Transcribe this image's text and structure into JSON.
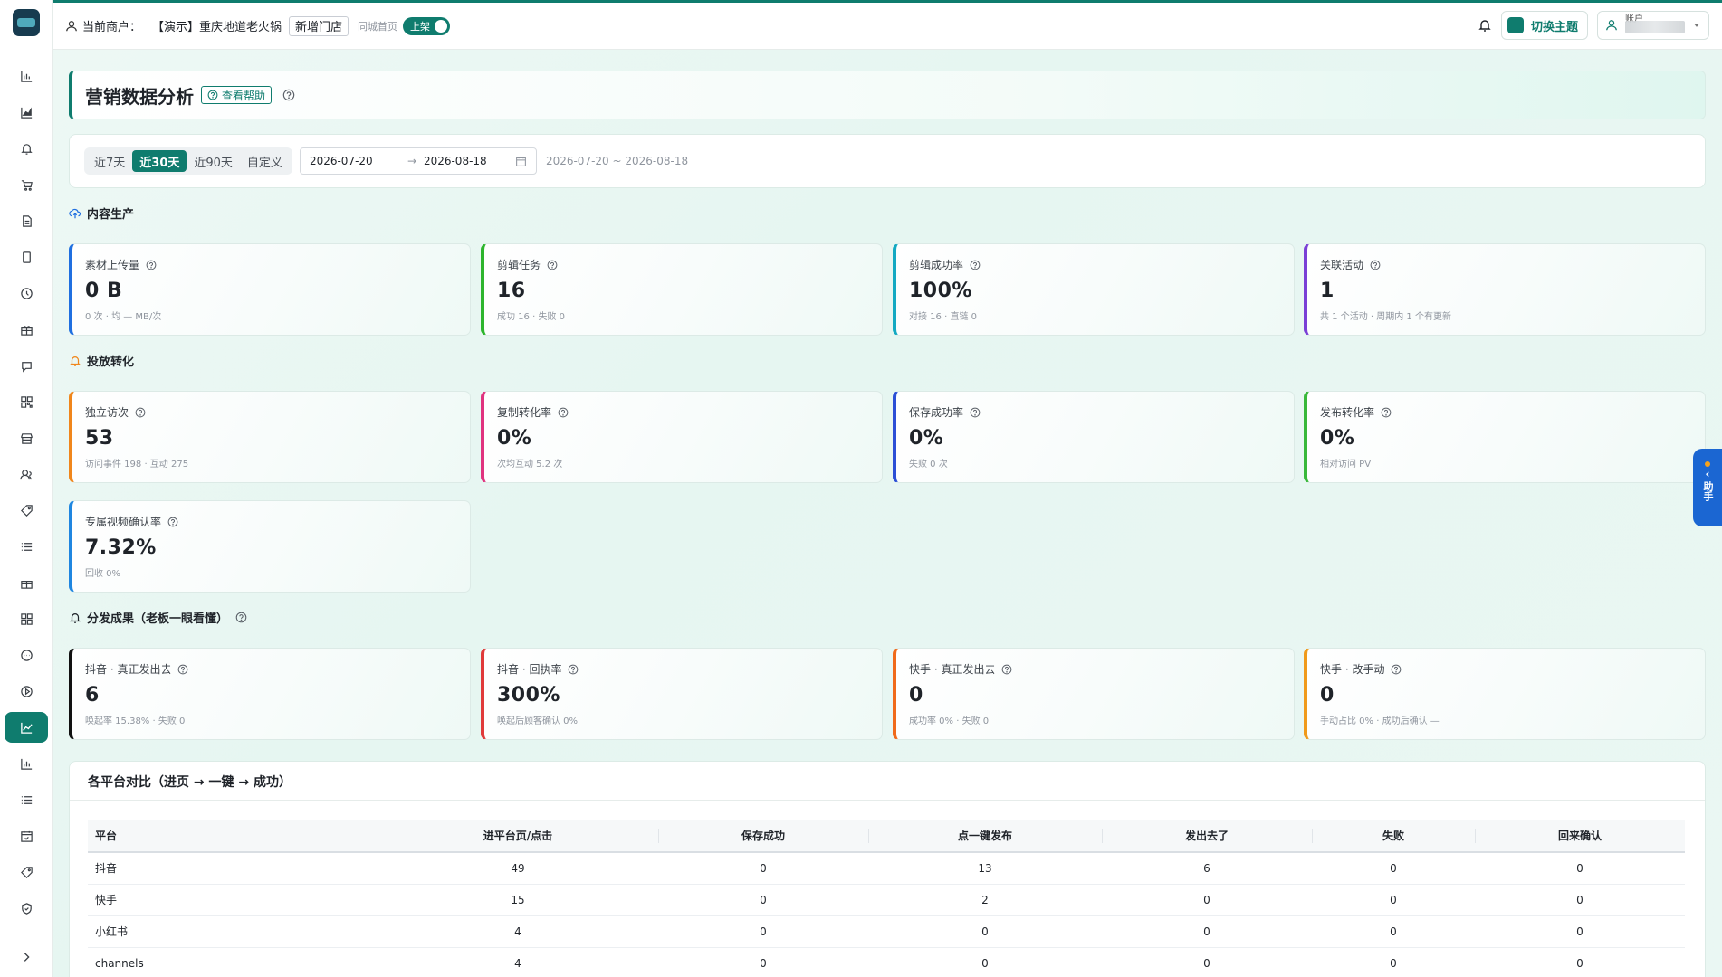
{
  "topbar": {
    "merchant_label": "当前商户：",
    "merchant_name": "【演示】重庆地道老火锅",
    "add_store": "新增门店",
    "city_home_label": "同城首页",
    "toggle_label": "上架",
    "theme_button": "切换主题",
    "user_name_short": "账户"
  },
  "header": {
    "title": "营销数据分析",
    "help_button": "查看帮助"
  },
  "filter": {
    "segments": [
      "近7天",
      "近30天",
      "近90天",
      "自定义"
    ],
    "active_segment": "近30天",
    "start_date": "2026-07-20",
    "end_date": "2026-08-18",
    "range_text": "2026-07-20 ~ 2026-08-18"
  },
  "sections": {
    "content": "内容生产",
    "delivery": "投放转化",
    "distribution": "分发成果（老板一眼看懂）"
  },
  "kpis": {
    "content": [
      {
        "label": "素材上传量",
        "value": "0 B",
        "sub": "0 次 · 均 — MB/次",
        "color": "#1f6fe0"
      },
      {
        "label": "剪辑任务",
        "value": "16",
        "sub": "成功 16 · 失败 0",
        "color": "#2db52d"
      },
      {
        "label": "剪辑成功率",
        "value": "100%",
        "sub": "对接 16 · 直链 0",
        "color": "#14a9c2"
      },
      {
        "label": "关联活动",
        "value": "1",
        "sub": "共 1 个活动 · 周期内 1 个有更新",
        "color": "#7a3fd6"
      }
    ],
    "delivery": [
      {
        "label": "独立访次",
        "value": "53",
        "sub": "访问事件 198 · 互动 275",
        "color": "#f0861b"
      },
      {
        "label": "复制转化率",
        "value": "0%",
        "sub": "次均互动 5.2 次",
        "color": "#e0337f"
      },
      {
        "label": "保存成功率",
        "value": "0%",
        "sub": "失败 0 次",
        "color": "#2c4fd6"
      },
      {
        "label": "发布转化率",
        "value": "0%",
        "sub": "相对访问 PV",
        "color": "#39b83a"
      },
      {
        "label": "专属视频确认率",
        "value": "7.32%",
        "sub": "回收 0%",
        "color": "#1f86e0"
      }
    ],
    "distribution": [
      {
        "label": "抖音 · 真正发出去",
        "value": "6",
        "sub": "唤起率 15.38% · 失败 0",
        "color": "#111111"
      },
      {
        "label": "抖音 · 回执率",
        "value": "300%",
        "sub": "唤起后顾客确认 0%",
        "color": "#e03a3a"
      },
      {
        "label": "快手 · 真正发出去",
        "value": "0",
        "sub": "成功率 0% · 失败 0",
        "color": "#f06a1b"
      },
      {
        "label": "快手 · 改手动",
        "value": "0",
        "sub": "手动占比 0% · 成功后确认 —",
        "color": "#f09a1b"
      }
    ]
  },
  "platform_table": {
    "title": "各平台对比（进页 → 一键 → 成功）",
    "columns": [
      "平台",
      "进平台页/点击",
      "保存成功",
      "点一键发布",
      "发出去了",
      "失败",
      "回来确认"
    ],
    "rows": [
      [
        "抖音",
        "49",
        "0",
        "13",
        "6",
        "0",
        "0"
      ],
      [
        "快手",
        "15",
        "0",
        "2",
        "0",
        "0",
        "0"
      ],
      [
        "小红书",
        "4",
        "0",
        "0",
        "0",
        "0",
        "0"
      ],
      [
        "channels",
        "4",
        "0",
        "0",
        "0",
        "0",
        "0"
      ]
    ]
  },
  "assistant": {
    "label": "助手"
  },
  "colors": {
    "accent": "#0f7c6e",
    "assistant": "#1b66d2"
  }
}
